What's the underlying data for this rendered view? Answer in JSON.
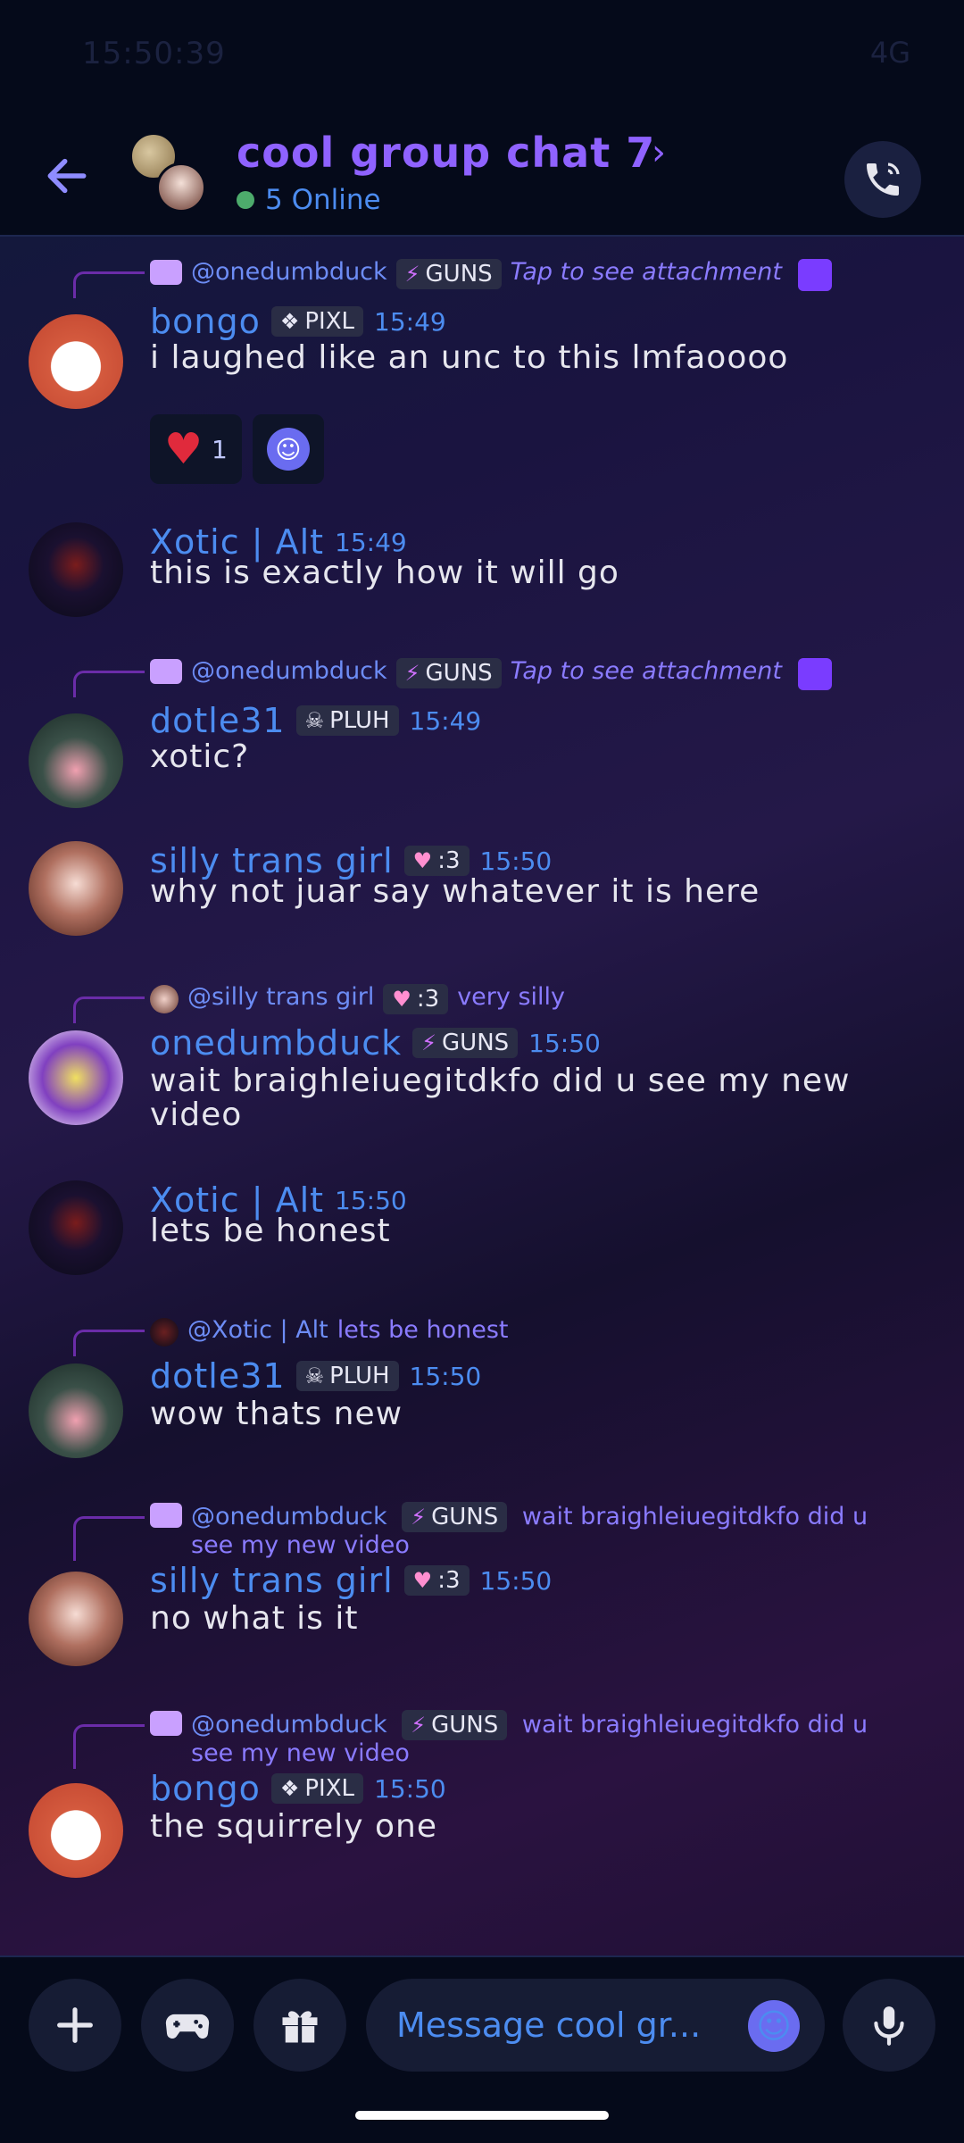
{
  "status": {
    "time": "15:50:39",
    "network": "4G"
  },
  "header": {
    "title": "cool group chat 7",
    "online": "5 Online"
  },
  "messages": [
    {
      "reply": {
        "name": "@onedumbduck",
        "badge": "GUNS",
        "text": "Tap to see attachment"
      },
      "author": "bongo",
      "badge": "PIXL",
      "time": "15:49",
      "text": "i laughed like an unc to this lmfaoooo",
      "reactions": [
        {
          "emoji": "heart",
          "count": "1"
        }
      ]
    },
    {
      "author": "Xotic | Alt",
      "time": "15:49",
      "text": "this is exactly how it will go"
    },
    {
      "reply": {
        "name": "@onedumbduck",
        "badge": "GUNS",
        "text": "Tap to see attachment"
      },
      "author": "dotle31",
      "badge": "PLUH",
      "time": "15:49",
      "text": "xotic?"
    },
    {
      "author": "silly trans girl",
      "badge": ":3",
      "time": "15:50",
      "text": "why not juar say whatever it is here"
    },
    {
      "reply": {
        "name": "@silly trans girl",
        "badge": ":3",
        "text": "very silly"
      },
      "author": "onedumbduck",
      "badge": "GUNS",
      "time": "15:50",
      "text": "wait braighleiuegitdkfo did u see my new video"
    },
    {
      "author": "Xotic | Alt",
      "time": "15:50",
      "text": "lets be honest"
    },
    {
      "reply": {
        "name": "@Xotic | Alt",
        "text": "lets be honest"
      },
      "author": "dotle31",
      "badge": "PLUH",
      "time": "15:50",
      "text": "wow thats new"
    },
    {
      "reply": {
        "name": "@onedumbduck",
        "badge": "GUNS",
        "text": "wait braighleiuegitdkfo did u see my new video"
      },
      "author": "silly trans girl",
      "badge": ":3",
      "time": "15:50",
      "text": "no what is it"
    },
    {
      "reply": {
        "name": "@onedumbduck",
        "badge": "GUNS",
        "text": "wait braighleiuegitdkfo did u see my new video"
      },
      "author": "bongo",
      "badge": "PIXL",
      "time": "15:50",
      "text": "the squirrely one"
    }
  ],
  "composer": {
    "placeholder": "Message cool gr..."
  },
  "colors": {
    "accent": "#8f62ff",
    "username": "#4c8cf0",
    "background": "#050a1a"
  },
  "icons": {
    "back": "arrow-left-icon",
    "call": "phone-call-icon",
    "add": "plus-icon",
    "games": "gamepad-icon",
    "gift": "gift-icon",
    "emoji": "smile-icon",
    "mic": "microphone-icon"
  }
}
